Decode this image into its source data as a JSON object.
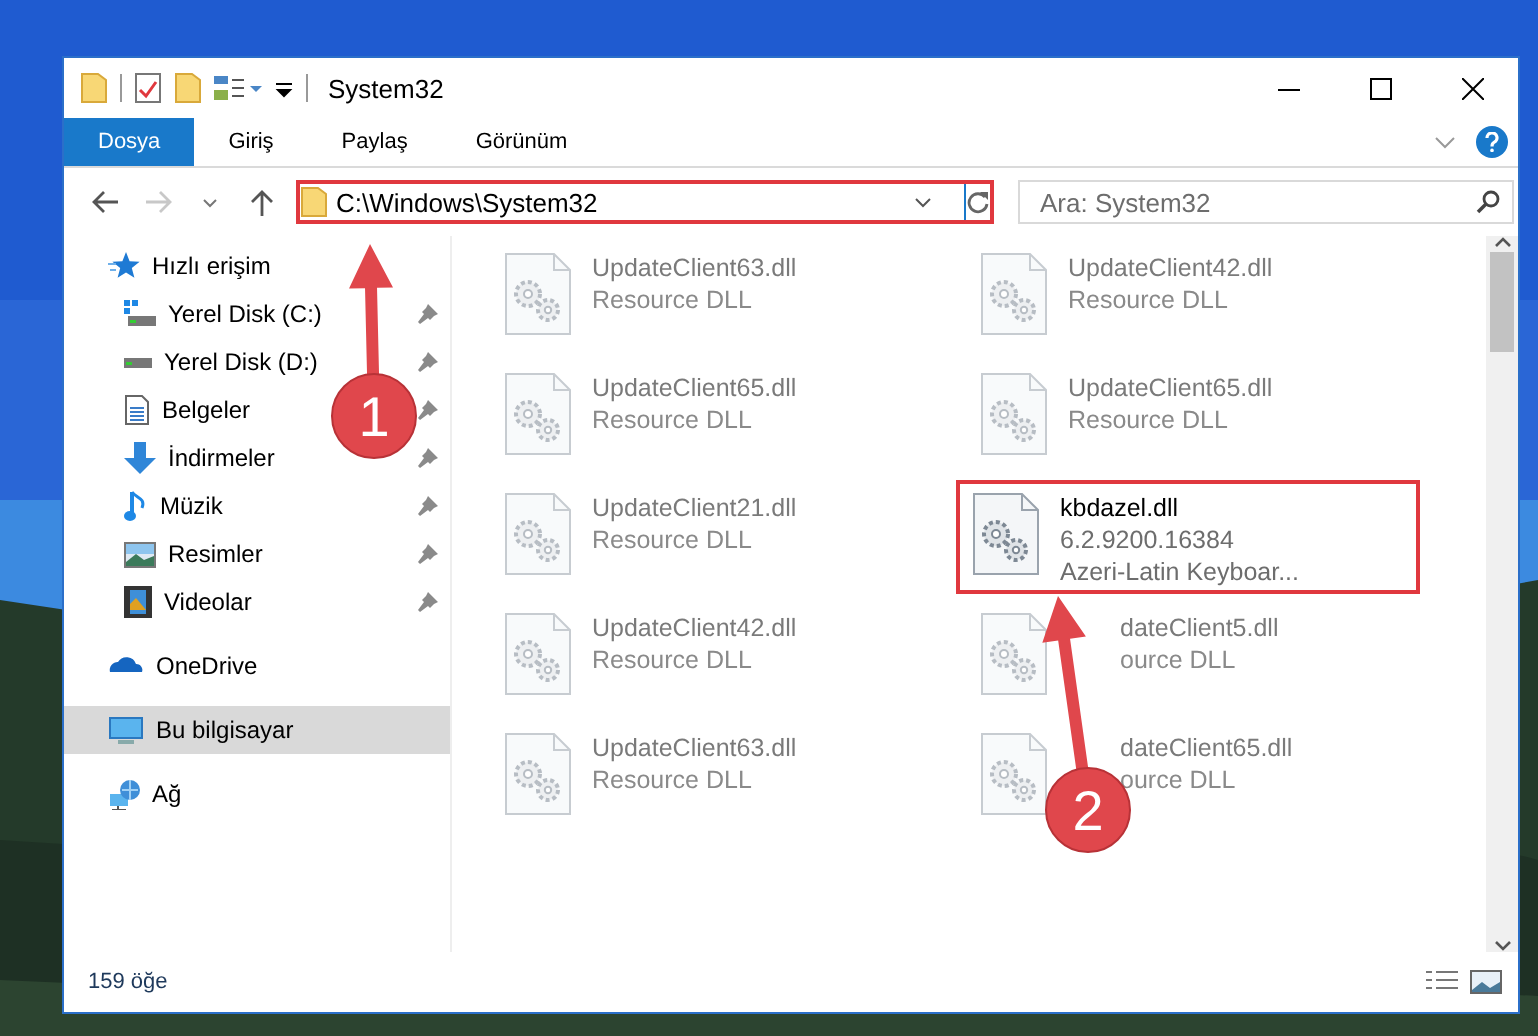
{
  "window": {
    "title": "System32"
  },
  "ribbon": {
    "tabs": [
      {
        "label": "Dosya",
        "selected": true
      },
      {
        "label": "Giriş",
        "selected": false
      },
      {
        "label": "Paylaş",
        "selected": false
      },
      {
        "label": "Görünüm",
        "selected": false
      }
    ]
  },
  "address": {
    "value": "C:\\Windows\\System32",
    "highlighted": true
  },
  "search": {
    "placeholder": "Ara: System32"
  },
  "nav": {
    "items": [
      {
        "label": "Hızlı erişim",
        "selected": false,
        "children": [
          {
            "label": "Yerel Disk (C:)",
            "pinned": true,
            "selected": false
          },
          {
            "label": "Yerel Disk (D:)",
            "pinned": true,
            "selected": false
          },
          {
            "label": "Belgeler",
            "pinned": true,
            "selected": false
          },
          {
            "label": "İndirmeler",
            "pinned": true,
            "selected": false
          },
          {
            "label": "Müzik",
            "pinned": true,
            "selected": false
          },
          {
            "label": "Resimler",
            "pinned": true,
            "selected": false
          },
          {
            "label": "Videolar",
            "pinned": true,
            "selected": false
          }
        ]
      },
      {
        "label": "OneDrive",
        "selected": false
      },
      {
        "label": "Bu bilgisayar",
        "selected": true
      },
      {
        "label": "Ağ",
        "selected": false
      }
    ]
  },
  "files": [
    {
      "name": "UpdateClient63.dll",
      "details": [
        "Resource DLL"
      ],
      "blurred": true,
      "highlighted": false
    },
    {
      "name": "UpdateClient42.dll",
      "details": [
        "Resource DLL"
      ],
      "blurred": true,
      "highlighted": false
    },
    {
      "name": "UpdateClient65.dll",
      "details": [
        "Resource DLL"
      ],
      "blurred": true,
      "highlighted": false
    },
    {
      "name": "UpdateClient65.dll",
      "details": [
        "Resource DLL"
      ],
      "blurred": true,
      "highlighted": false
    },
    {
      "name": "UpdateClient21.dll",
      "details": [
        "Resource DLL"
      ],
      "blurred": true,
      "highlighted": false
    },
    {
      "name": "kbdazel.dll",
      "details": [
        "6.2.9200.16384",
        "Azeri-Latin Keyboar..."
      ],
      "blurred": false,
      "highlighted": true
    },
    {
      "name": "UpdateClient42.dll",
      "details": [
        "Resource DLL"
      ],
      "blurred": true,
      "highlighted": false
    },
    {
      "name": "dateClient5.dll",
      "details": [
        "ource DLL"
      ],
      "blurred": true,
      "highlighted": false,
      "kind": "covered"
    },
    {
      "name": "UpdateClient63.dll",
      "details": [
        "Resource DLL"
      ],
      "blurred": true,
      "highlighted": false
    },
    {
      "name": "dateClient65.dll",
      "details": [
        "ource DLL"
      ],
      "blurred": true,
      "highlighted": false,
      "kind": "covered"
    }
  ],
  "status_bar": {
    "count": "159 öğe"
  },
  "callouts": [
    {
      "label": "1"
    },
    {
      "label": "2"
    }
  ]
}
